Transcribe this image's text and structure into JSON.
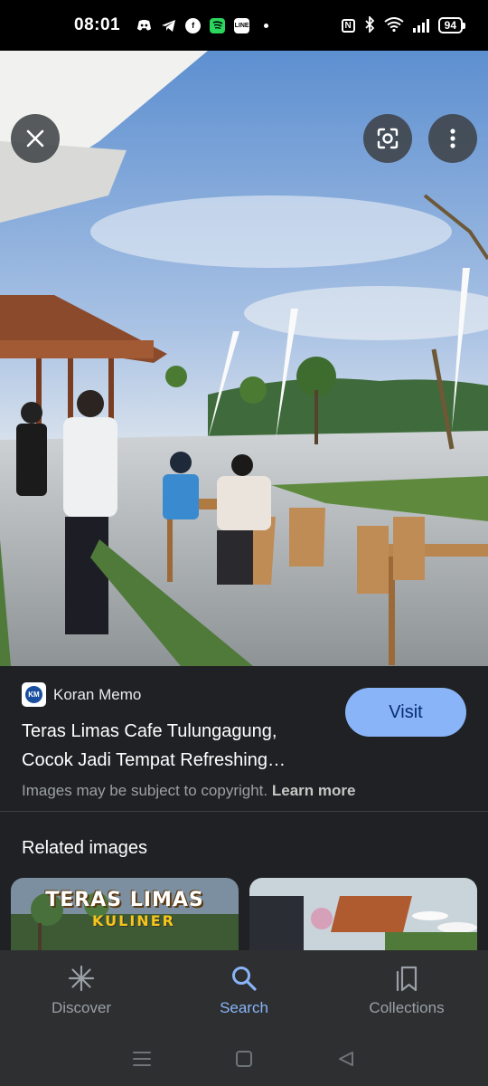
{
  "status_bar": {
    "time": "08:01",
    "battery": "94",
    "nfc": "N",
    "apps": [
      "discord-icon",
      "telegram-icon",
      "facebook-icon",
      "spotify-icon",
      "line-icon"
    ]
  },
  "photo": {
    "description_icons": [
      "close-icon",
      "lens-icon",
      "more-vert-icon"
    ]
  },
  "result": {
    "source": "Koran Memo",
    "source_logo_text": "KM",
    "title": "Teras Limas Cafe Tulungagung, Cocok Jadi Tempat Refreshing…",
    "visit_label": "Visit",
    "copyright_text": "Images may be subject to copyright.",
    "learn_more": "Learn more"
  },
  "related": {
    "heading": "Related images",
    "cards": [
      {
        "main": "TERAS LIMAS",
        "sub": "KULINER"
      },
      {
        "main": "",
        "sub": ""
      }
    ]
  },
  "bottom_nav": {
    "items": [
      {
        "label": "Discover",
        "icon": "asterisk-icon",
        "active": false
      },
      {
        "label": "Search",
        "icon": "search-icon",
        "active": true
      },
      {
        "label": "Collections",
        "icon": "bookmarks-icon",
        "active": false
      }
    ]
  },
  "colors": {
    "accent": "#8ab4f8",
    "background": "#202124",
    "nav_background": "#2d2f31"
  }
}
